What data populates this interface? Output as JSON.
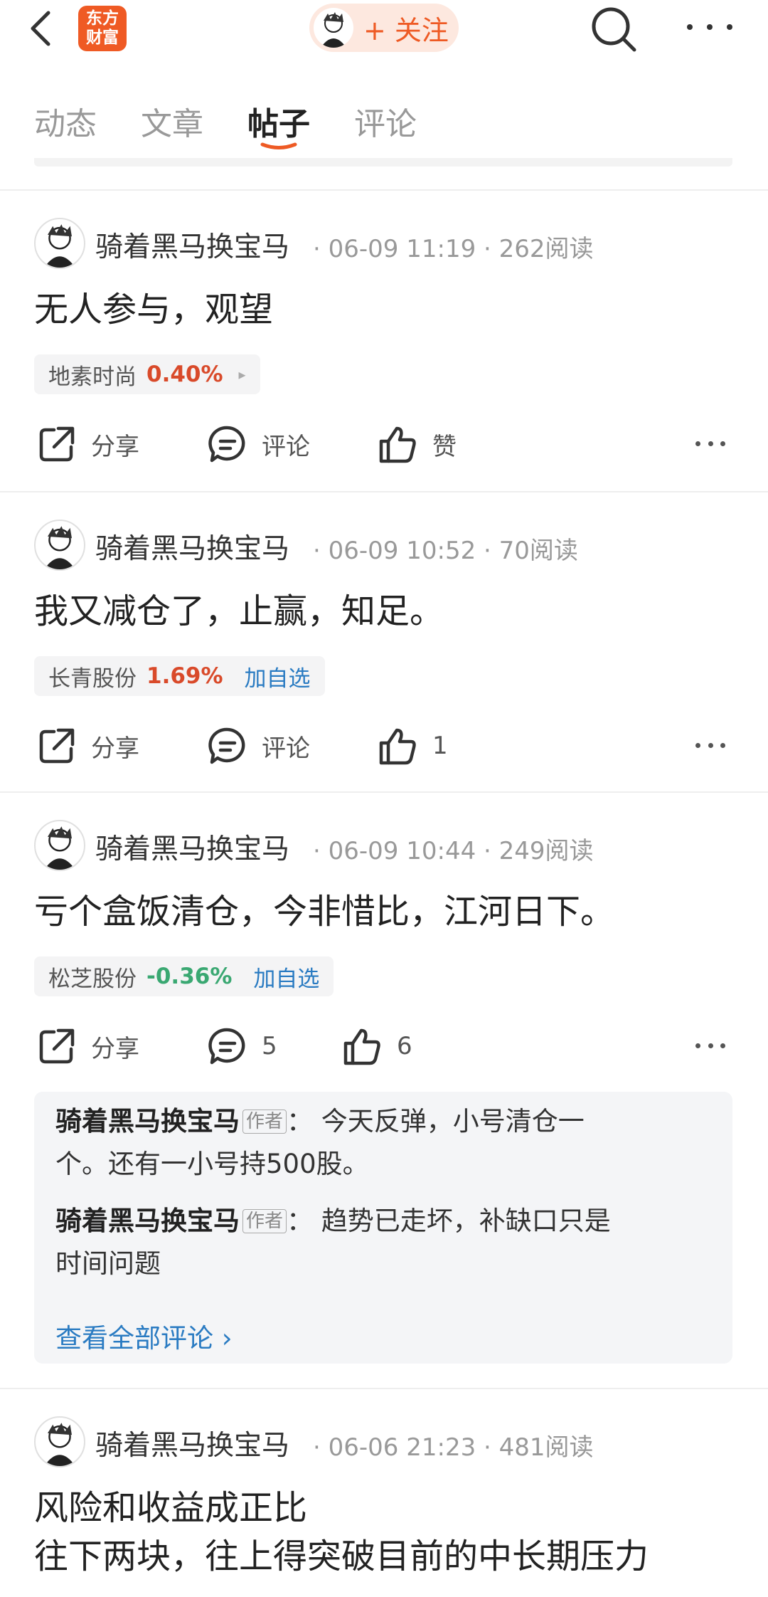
{
  "header": {
    "logo_line1": "东方",
    "logo_line2": "财富",
    "follow_label": "+ 关注",
    "icons": [
      "back-icon",
      "search-icon",
      "more-icon"
    ]
  },
  "tabs": [
    {
      "label": "动态"
    },
    {
      "label": "文章"
    },
    {
      "label": "帖子",
      "active": true
    },
    {
      "label": "评论"
    }
  ],
  "colors": {
    "accent": "#ee5a24",
    "up": "#d94a2a",
    "down": "#3aa872",
    "link": "#2a7bc2"
  },
  "posts": [
    {
      "author": "骑着黑马换宝马",
      "datetime": "06-09 11:19",
      "reads": "262阅读",
      "content": "无人参与，观望",
      "stock": {
        "name": "地素时尚",
        "pct": "0.40%",
        "extra": "▸"
      },
      "actions": {
        "share": "分享",
        "comment": "评论",
        "like": "赞"
      }
    },
    {
      "author": "骑着黑马换宝马",
      "datetime": "06-09 10:52",
      "reads": "70阅读",
      "content": "我又减仓了，止赢，知足。",
      "stock": {
        "name": "长青股份",
        "pct": "1.69%",
        "extra": "加自选"
      },
      "actions": {
        "share": "分享",
        "comment": "评论",
        "like": "1"
      }
    },
    {
      "author": "骑着黑马换宝马",
      "datetime": "06-09 10:44",
      "reads": "249阅读",
      "content": "亏个盒饭清仓，今非惜比，江河日下。",
      "stock": {
        "name": "松芝股份",
        "pct": "-0.36%",
        "extra": "加自选"
      },
      "actions": {
        "share": "分享",
        "comment": "5",
        "like": "6"
      },
      "comments": [
        {
          "author": "骑着黑马换宝马",
          "badge": "作者",
          "sep": "：",
          "line1": "今天反弹，小号清仓一",
          "line2": "个。还有一小号持500股。"
        },
        {
          "author": "骑着黑马换宝马",
          "badge": "作者",
          "sep": "：",
          "line1": "趋势已走坏，补缺口只是",
          "line2": "时间问题"
        }
      ],
      "view_all": "查看全部评论 ›"
    },
    {
      "author": "骑着黑马换宝马",
      "datetime": "06-06 21:23",
      "reads": "481阅读",
      "content_line1": "风险和收益成正比",
      "content_line2": "往下两块，往上得突破目前的中长期压力"
    }
  ]
}
